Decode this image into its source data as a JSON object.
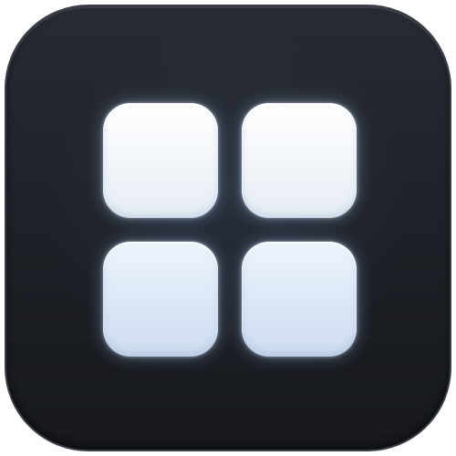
{
  "icon": {
    "name": "grid-four-squares-icon",
    "colors": {
      "background": "#1f2228",
      "border": "#3a3f47",
      "tile_top": "#f4f7fb",
      "tile_bottom": "#dce8f7",
      "glow": "#b4d2ff"
    },
    "tiles": [
      {
        "position": "top-left"
      },
      {
        "position": "top-right"
      },
      {
        "position": "bottom-left"
      },
      {
        "position": "bottom-right"
      }
    ]
  }
}
